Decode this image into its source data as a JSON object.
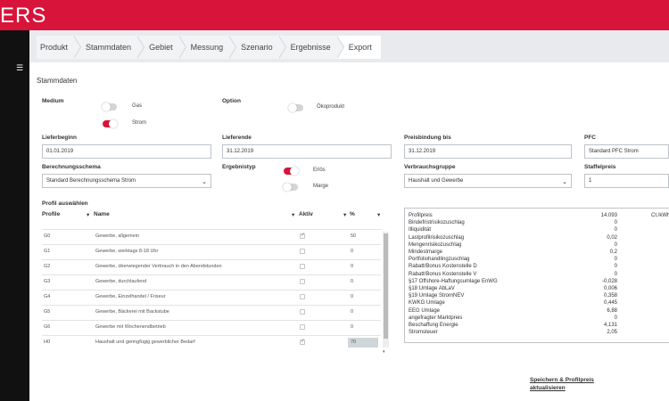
{
  "app": {
    "logo": "ERS"
  },
  "tabs": [
    "Produkt",
    "Stammdaten",
    "Gebiet",
    "Messung",
    "Szenario",
    "Ergebnisse",
    "Export"
  ],
  "page": {
    "title": "Stammdaten"
  },
  "medium": {
    "label": "Medium",
    "gas": "Gas",
    "strom": "Strom"
  },
  "option": {
    "label": "Option",
    "oeko": "Ökoprodukt"
  },
  "lieferbeginn": {
    "label": "Lieferbeginn",
    "value": "01.01.2019"
  },
  "lieferende": {
    "label": "Lieferende",
    "value": "31.12.2019"
  },
  "preisbindung": {
    "label": "Preisbindung bis",
    "value": "31.12.2019"
  },
  "pfc": {
    "label": "PFC",
    "value": "Standard PFC Strom"
  },
  "berechnungsschema": {
    "label": "Berechnungsschema",
    "value": "Standard Berechnungsschema Strom"
  },
  "ergebnistyp": {
    "label": "Ergebnistyp",
    "erloes": "Erlös",
    "marge": "Marge"
  },
  "verbrauchsgruppe": {
    "label": "Verbrauchsgruppe",
    "value": "Haushalt und Gewerbe"
  },
  "staffelpreis": {
    "label": "Staffelpreis",
    "value": "1"
  },
  "profile": {
    "label": "Profil auswählen",
    "headers": {
      "profile": "Profile",
      "name": "Name",
      "aktiv": "Aktiv",
      "pct": "%"
    },
    "rows": [
      {
        "code": "G0",
        "name": "Gewerbe, allgemein",
        "checked": true,
        "pct": "50"
      },
      {
        "code": "G1",
        "name": "Gewerbe, werktags 8-18 Uhr",
        "checked": false,
        "pct": "0"
      },
      {
        "code": "G2",
        "name": "Gewerbe, überwiegender Verbrauch in den Abendstunden",
        "checked": false,
        "pct": "0"
      },
      {
        "code": "G3",
        "name": "Gewerbe, durchlaufend",
        "checked": false,
        "pct": "0"
      },
      {
        "code": "G4",
        "name": "Gewerbe, Einzelhandel / Friseur",
        "checked": false,
        "pct": "0"
      },
      {
        "code": "G5",
        "name": "Gewerbe, Bäckerei mit Backstube",
        "checked": false,
        "pct": "0"
      },
      {
        "code": "G6",
        "name": "Gewerbe mit Wochenendbetrieb",
        "checked": false,
        "pct": "0"
      },
      {
        "code": "H0",
        "name": "Haushalt und geringfügig gewerblicher Bedarf",
        "checked": true,
        "pct": "70"
      }
    ]
  },
  "prices": {
    "unit": "Ct./kWh",
    "rows": [
      {
        "label": "Profilpreis",
        "value": "14.093"
      },
      {
        "label": "Bindefristrisikozuschlag",
        "value": "0"
      },
      {
        "label": "Illiquidität",
        "value": "0"
      },
      {
        "label": "Lastprofilrisikozuschlag",
        "value": "0,02"
      },
      {
        "label": "Mengenrisikozuschlag",
        "value": "0"
      },
      {
        "label": "Mindestmarge",
        "value": "0,2"
      },
      {
        "label": "Portfoliohandlingzuschlag",
        "value": "0"
      },
      {
        "label": "Rabatt/Bonus Kostenstelle D",
        "value": "0"
      },
      {
        "label": "Rabatt/Bonus Kostenstelle V",
        "value": "0"
      },
      {
        "label": "§17 Offshore-Haftungsumlage EnWG",
        "value": "-0,028"
      },
      {
        "label": "§18 Umlage AbLaV",
        "value": "0,006"
      },
      {
        "label": "§19 Umlage StromNEV",
        "value": "0,358"
      },
      {
        "label": "KWKG Umlage",
        "value": "0,445"
      },
      {
        "label": "EEG Umlage",
        "value": "6,88"
      },
      {
        "label": "angefragter Marktpreis",
        "value": "0"
      },
      {
        "label": "Beschaffung Energie",
        "value": "4,131"
      },
      {
        "label": "Stromsteuer",
        "value": "2,05"
      }
    ]
  },
  "actions": {
    "save_line1": "Speichern & Profilpreis",
    "save_line2": "aktualisieren"
  }
}
